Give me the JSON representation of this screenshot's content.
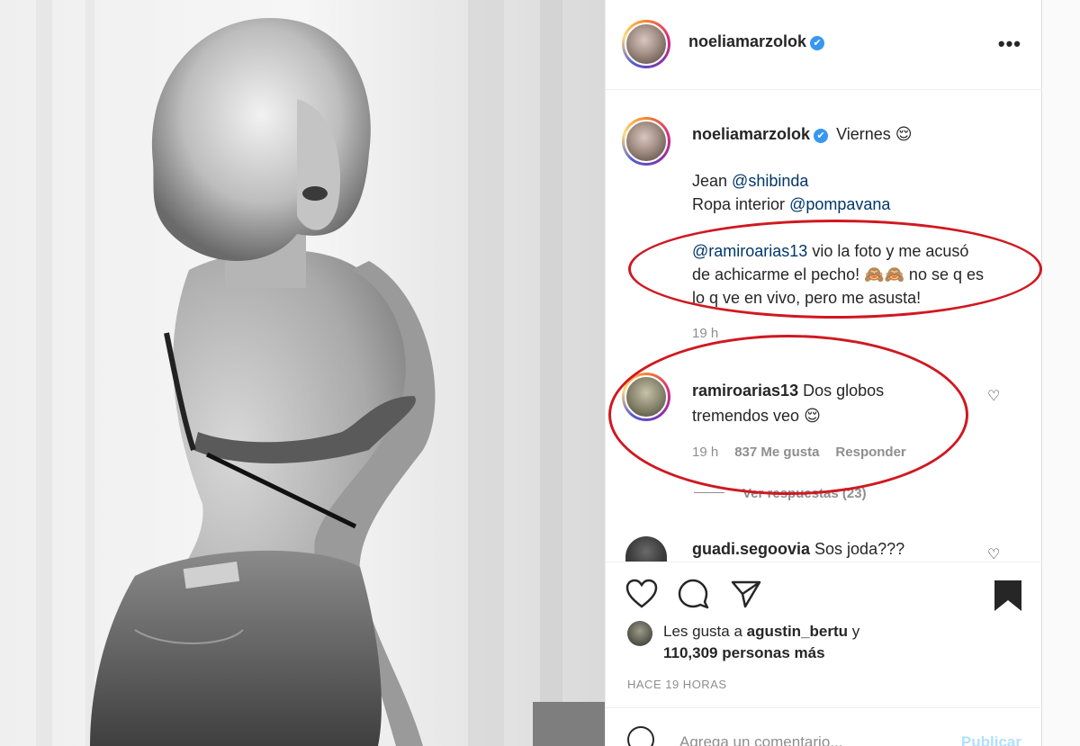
{
  "post": {
    "username": "noeliamarzolok",
    "verified_mark": "✔",
    "more_label": "•••"
  },
  "caption": {
    "username": "noeliamarzolok",
    "title": "Viernes 😌",
    "line1_prefix": "Jean ",
    "line1_mention": "@shibinda",
    "line2_prefix": "Ropa interior ",
    "line2_mention": "@pompavana",
    "para_mention": "@ramiroarias13",
    "para_l1": " vio la foto y me acusó",
    "para_l2": "de achicarme el pecho! 🙈🙈 no se q es",
    "para_l3": "lo q ve en vivo, pero me asusta!",
    "time": "19 h"
  },
  "comments": [
    {
      "username": "ramiroarias13",
      "text_l1": " Dos globos",
      "text_l2": "tremendos veo 😌",
      "time": "19 h",
      "likes": "837 Me gusta",
      "reply": "Responder",
      "view_replies": "Ver respuestas (23)"
    },
    {
      "username": "guadi.segoovia",
      "text": " Sos joda???"
    }
  ],
  "likes": {
    "prefix": "Les gusta a ",
    "user": "agustin_bertu",
    "join": " y",
    "count": "110,309 personas más"
  },
  "timestamp": "HACE 19 HORAS",
  "comment_box": {
    "placeholder": "Agrega un comentario...",
    "publish": "Publicar"
  },
  "icons": [
    "heart-icon",
    "comment-icon",
    "share-icon",
    "bookmark-icon",
    "emoji-icon"
  ],
  "colors": {
    "annotation": "#d01820",
    "link": "#00376b",
    "verified": "#3897f0"
  }
}
